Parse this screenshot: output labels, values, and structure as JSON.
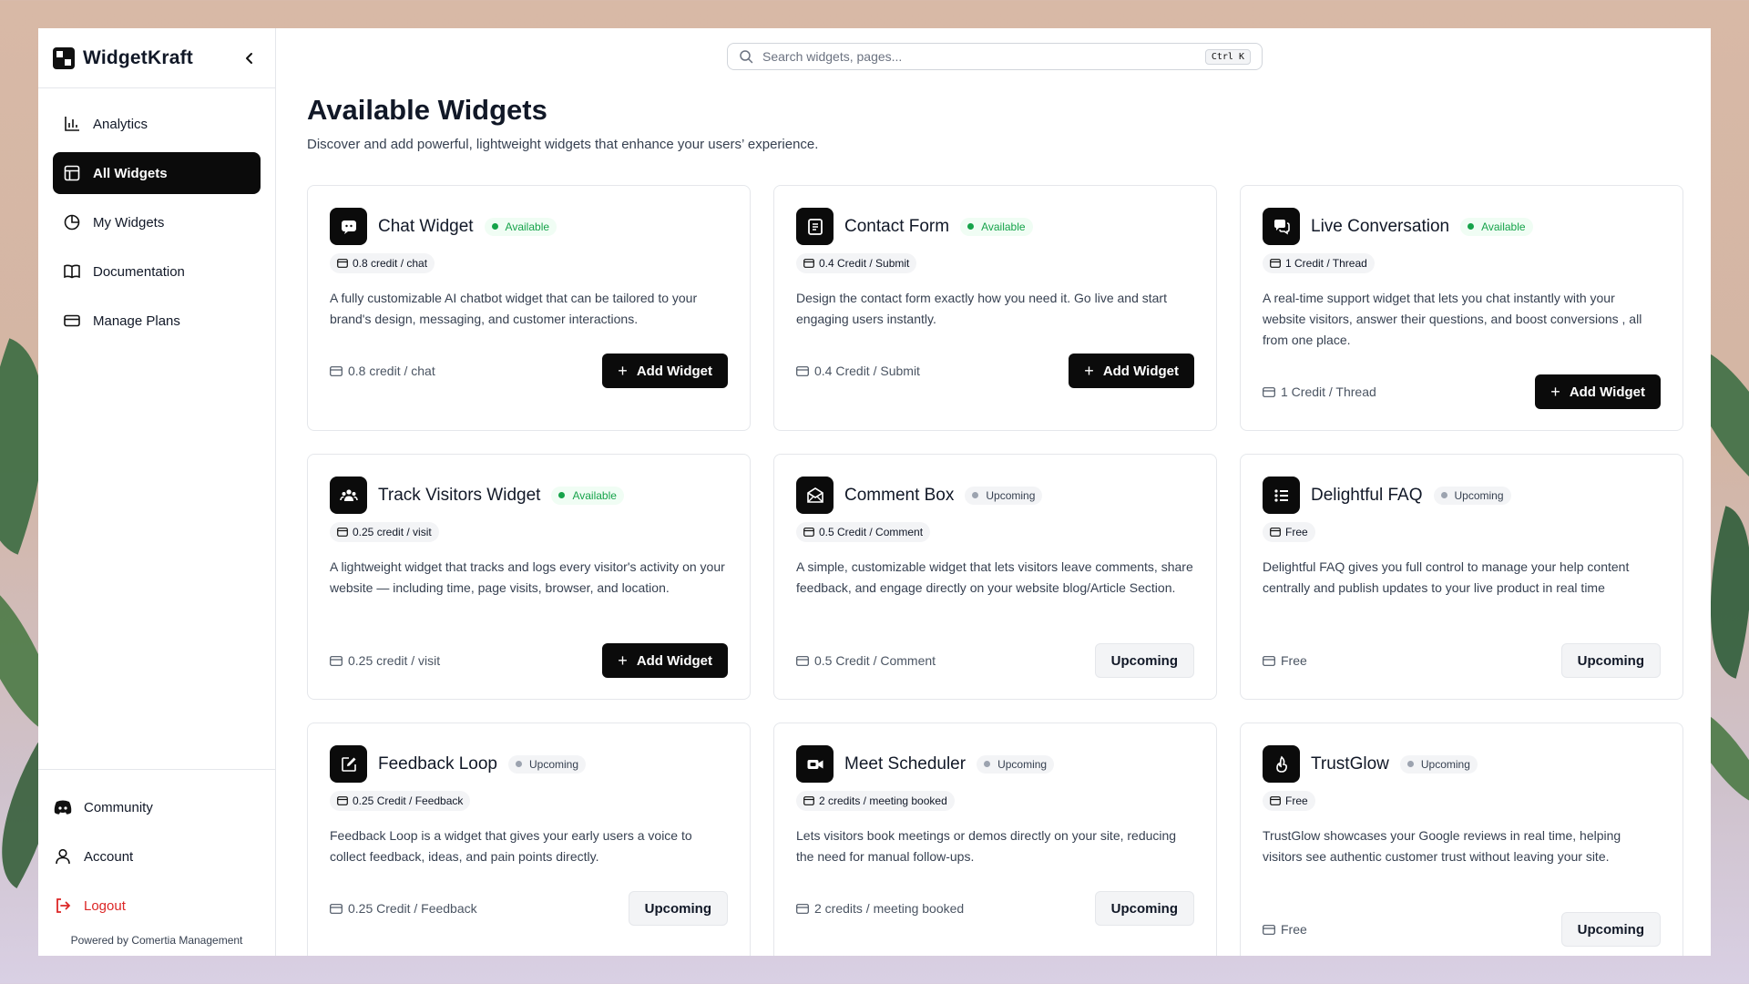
{
  "brand": {
    "name": "WidgetKraft"
  },
  "sidebar": {
    "items": [
      {
        "label": "Analytics",
        "icon": "bar-chart-icon",
        "active": false
      },
      {
        "label": "All Widgets",
        "icon": "layout-icon",
        "active": true
      },
      {
        "label": "My Widgets",
        "icon": "pie-chart-icon",
        "active": false
      },
      {
        "label": "Documentation",
        "icon": "book-icon",
        "active": false
      },
      {
        "label": "Manage Plans",
        "icon": "credit-card-icon",
        "active": false
      }
    ],
    "bottom": [
      {
        "label": "Community",
        "icon": "discord-icon"
      },
      {
        "label": "Account",
        "icon": "user-icon"
      },
      {
        "label": "Logout",
        "icon": "logout-icon"
      }
    ],
    "powered_by": "Powered by Comertia Management"
  },
  "search": {
    "placeholder": "Search widgets, pages...",
    "shortcut": "Ctrl K"
  },
  "page": {
    "title": "Available Widgets",
    "subtitle": "Discover and add powerful, lightweight widgets that enhance your users’ experience."
  },
  "buttons": {
    "add": "Add Widget",
    "upcoming": "Upcoming"
  },
  "colors": {
    "accent": "#0b0b0b",
    "available": "#16a34a",
    "logout": "#dc2626"
  },
  "widgets": [
    {
      "title": "Chat Widget",
      "status": "Available",
      "price": "0.8 credit / chat",
      "icon": "chat-bot-icon",
      "description": "A fully customizable AI chatbot widget that can be tailored to your brand's design, messaging, and customer interactions."
    },
    {
      "title": "Contact Form",
      "status": "Available",
      "price": "0.4 Credit / Submit",
      "icon": "contact-form-icon",
      "description": "Design the contact form exactly how you need it. Go live and start engaging users instantly."
    },
    {
      "title": "Live Conversation",
      "status": "Available",
      "price": "1 Credit / Thread",
      "icon": "conversation-icon",
      "description": "A real-time support widget that lets you chat instantly with your website visitors, answer their questions, and boost conversions , all from one place."
    },
    {
      "title": "Track Visitors Widget",
      "status": "Available",
      "price": "0.25 credit / visit",
      "icon": "visitors-icon",
      "description": "A lightweight widget that tracks and logs every visitor's activity on your website — including time, page visits, browser, and location."
    },
    {
      "title": "Comment Box",
      "status": "Upcoming",
      "price": "0.5 Credit / Comment",
      "icon": "comment-box-icon",
      "description": "A simple, customizable widget that lets visitors leave comments, share feedback, and engage directly on your website blog/Article Section."
    },
    {
      "title": "Delightful FAQ",
      "status": "Upcoming",
      "price": "Free",
      "icon": "faq-list-icon",
      "description": "Delightful FAQ gives you full control to manage your help content centrally and publish updates to your live product in real time"
    },
    {
      "title": "Feedback Loop",
      "status": "Upcoming",
      "price": "0.25 Credit / Feedback",
      "icon": "feedback-edit-icon",
      "description": "Feedback Loop is a widget that gives your early users a voice to collect feedback, ideas, and pain points directly."
    },
    {
      "title": "Meet Scheduler",
      "status": "Upcoming",
      "price": "2 credits / meeting booked",
      "icon": "video-camera-icon",
      "description": "Lets visitors book meetings or demos directly on your site, reducing the need for manual follow-ups."
    },
    {
      "title": "TrustGlow",
      "status": "Upcoming",
      "price": "Free",
      "icon": "trust-badge-icon",
      "description": "TrustGlow showcases your Google reviews in real time, helping visitors see authentic customer trust without leaving your site."
    }
  ]
}
